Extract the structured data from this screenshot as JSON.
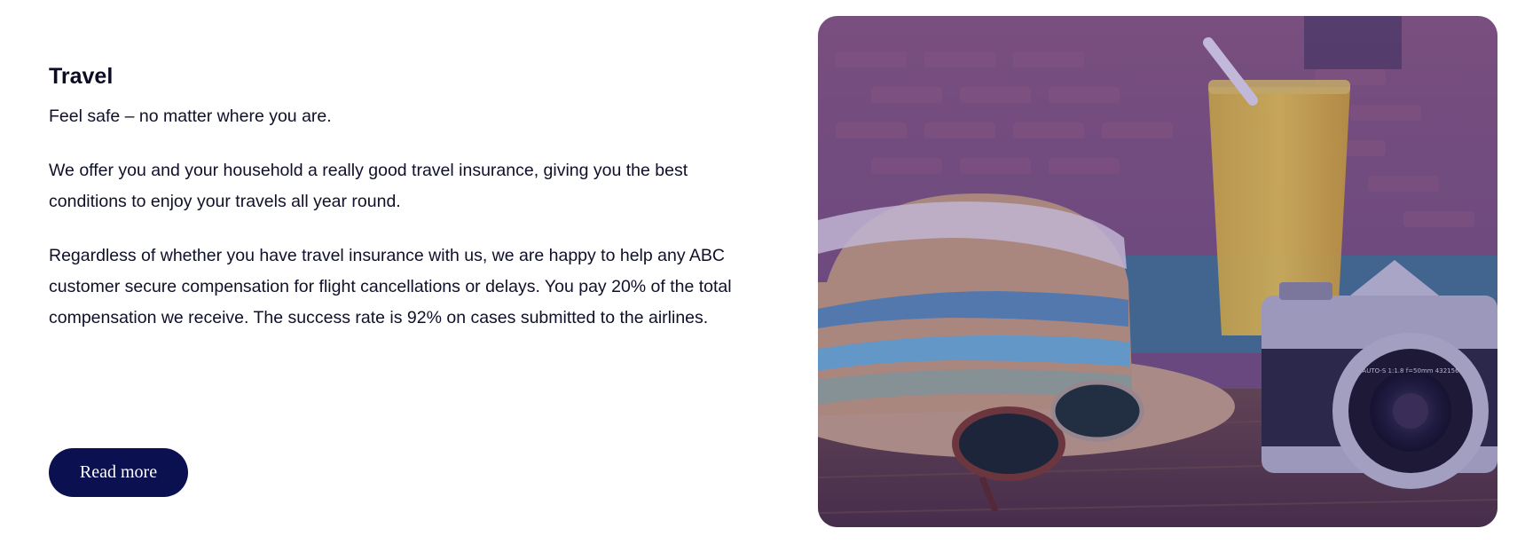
{
  "travel": {
    "title": "Travel",
    "tagline": "Feel safe – no matter where you are.",
    "paragraph_1": "We offer you and your household a really good travel insurance, giving you the best conditions to enjoy your travels all year round.",
    "paragraph_2": "Regardless of whether you have travel insurance with us, we are happy to help any ABC customer secure compensation for flight cancellations or delays. You pay 20% of the total compensation we receive. The success rate is 92% on cases submitted to the airlines.",
    "button_label": "Read more"
  },
  "photo": {
    "camera_lens_text": "AUTO-S 1:1.8 f=50mm 432156"
  },
  "colors": {
    "button_bg": "#0b1150",
    "text": "#0f1029",
    "photo_overlay": "#3a2a8c"
  }
}
